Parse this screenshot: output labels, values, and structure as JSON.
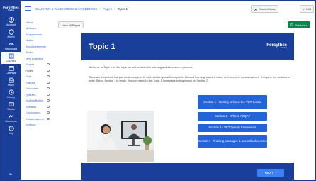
{
  "global_nav": {
    "brand": "Forsythes",
    "brand_sub": "Training",
    "items": [
      {
        "label": "Account",
        "icon": "account-icon"
      },
      {
        "label": "Admin",
        "icon": "admin-icon"
      },
      {
        "label": "Dashboard",
        "icon": "dashboard-icon"
      },
      {
        "label": "Courses",
        "icon": "courses-icon"
      },
      {
        "label": "Calendar",
        "icon": "calendar-icon"
      },
      {
        "label": "Inbox",
        "icon": "inbox-icon"
      },
      {
        "label": "History",
        "icon": "history-icon"
      },
      {
        "label": "Studio",
        "icon": "studio-icon"
      },
      {
        "label": "Commons",
        "icon": "commons-icon"
      },
      {
        "label": "Help",
        "icon": "help-icon"
      }
    ],
    "collapse": "⇤"
  },
  "topbar": {
    "breadcrumbs": [
      "CLUSTER 1 TAXIDERMIS & TAXIDERMIS",
      "Pages",
      "Topic 1"
    ],
    "student_view": "Student View",
    "edit": "Edit"
  },
  "course_nav": {
    "links": [
      {
        "label": "Home",
        "hidden": false
      },
      {
        "label": "Modules",
        "hidden": false
      },
      {
        "label": "Assignments",
        "hidden": false
      },
      {
        "label": "Marks",
        "hidden": false
      },
      {
        "label": "Announcements",
        "hidden": false
      },
      {
        "label": "Books",
        "hidden": false
      },
      {
        "label": "New Analytics",
        "hidden": false
      },
      {
        "label": "People",
        "hidden": true
      },
      {
        "label": "Pages",
        "hidden": true
      },
      {
        "label": "Files",
        "hidden": true
      },
      {
        "label": "Rubrics",
        "hidden": true
      },
      {
        "label": "Outcomes",
        "hidden": true
      },
      {
        "label": "Quizzes",
        "hidden": true
      },
      {
        "label": "BigBlueButton",
        "hidden": true
      },
      {
        "label": "Syllabus",
        "hidden": true
      },
      {
        "label": "Discussions",
        "hidden": true
      },
      {
        "label": "Collaborations",
        "hidden": true
      },
      {
        "label": "Settings",
        "hidden": false
      }
    ],
    "active_index": 8
  },
  "content": {
    "view_all_pages": "View All Pages",
    "published": "Published",
    "banner_title": "Topic 1",
    "banner_logo": "Forsythes",
    "banner_logo_sub": "Training",
    "intro": "Welcome to Topic 1. In this topic we will consider the learning and assessment process.",
    "instructions": "There are 4 sections that you must complete. In each section you will completed blended learning, watch a video, and complete an assessment. Complete the sections in order. Select Section 1 to begin. You can return to this Topic 1 homepage to begin work on Section 2.",
    "sections": [
      "Section 1 - Getting to know the VET Sector",
      "Section 2 - Who is ASQA?",
      "Section 3 - VET Quality Framework",
      "Section 4 - Training packages & accredited courses"
    ],
    "next": "NEXT"
  },
  "colors": {
    "brand_blue": "#1a3f9b",
    "button_blue": "#2563d8",
    "published_green": "#0b874b",
    "link_blue": "#3b6fd1"
  }
}
